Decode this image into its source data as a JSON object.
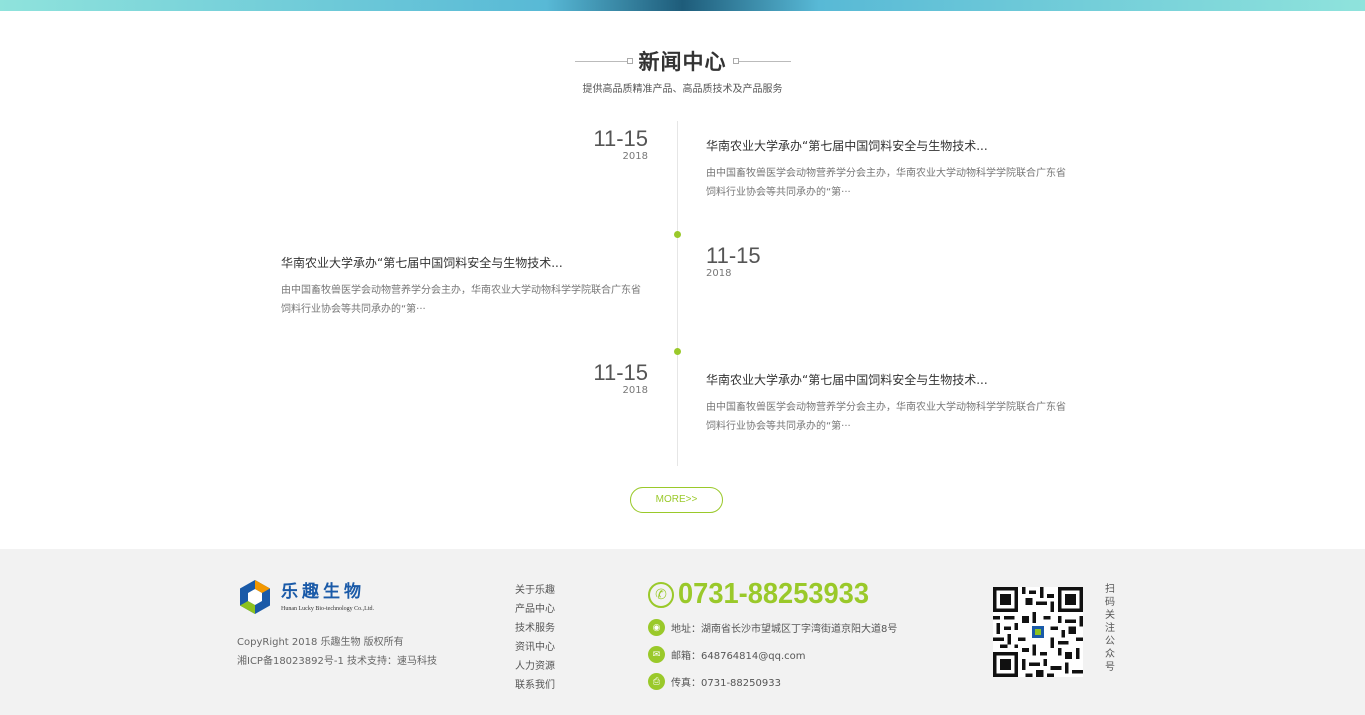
{
  "section": {
    "title": "新闻中心",
    "subtitle": "提供高品质精准产品、高品质技术及产品服务"
  },
  "news": [
    {
      "date_md": "11-15",
      "year": "2018",
      "title": "华南农业大学承办“第七届中国饲料安全与生物技术...",
      "desc": "由中国畜牧兽医学会动物营养学分会主办，华南农业大学动物科学学院联合广东省饲料行业协会等共同承办的“第···"
    },
    {
      "date_md": "11-15",
      "year": "2018",
      "title": "华南农业大学承办“第七届中国饲料安全与生物技术...",
      "desc": "由中国畜牧兽医学会动物营养学分会主办，华南农业大学动物科学学院联合广东省饲料行业协会等共同承办的“第···"
    },
    {
      "date_md": "11-15",
      "year": "2018",
      "title": "华南农业大学承办“第七届中国饲料安全与生物技术...",
      "desc": "由中国畜牧兽医学会动物营养学分会主办，华南农业大学动物科学学院联合广东省饲料行业协会等共同承办的“第···"
    }
  ],
  "more_label": "MORE>>",
  "footer": {
    "logo_cn": "乐趣生物",
    "logo_en": "Hunan Lucky Bio-technology Co.,Ltd.",
    "copyright": "CopyRight 2018 乐趣生物 版权所有",
    "icp": "湘ICP备18023892号-1 技术支持：速马科技",
    "nav": [
      "关于乐趣",
      "产品中心",
      "技术服务",
      "资讯中心",
      "人力资源",
      "联系我们"
    ],
    "phone": "0731-88253933",
    "address": "地址：湖南省长沙市望城区丁字湾街道京阳大道8号",
    "email": "邮箱：648764814@qq.com",
    "fax": "传真：0731-88250933",
    "qr_label": "扫码关注公众号"
  },
  "colors": {
    "accent": "#9ac92a",
    "brand_blue": "#1a5aa8",
    "footer_bg": "#f2f2f2"
  }
}
